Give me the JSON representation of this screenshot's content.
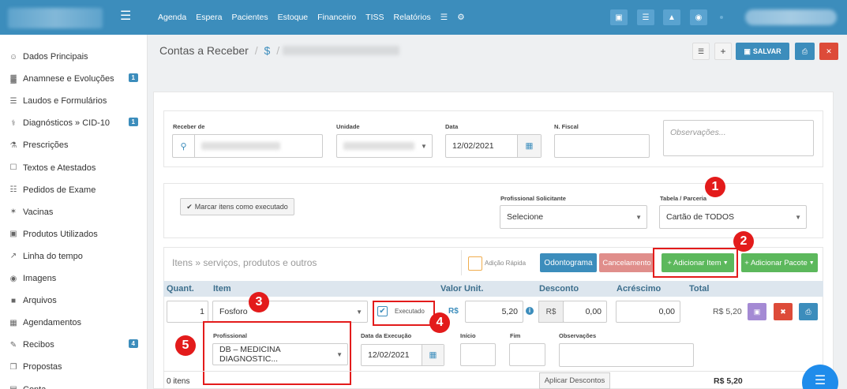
{
  "topnav": [
    "Agenda",
    "Espera",
    "Pacientes",
    "Estoque",
    "Financeiro",
    "TISS",
    "Relatórios"
  ],
  "sidebar": [
    {
      "label": "Dados Principais",
      "icon": "person-icon",
      "badge": ""
    },
    {
      "label": "Anamnese e Evoluções",
      "icon": "chart-icon",
      "badge": "1"
    },
    {
      "label": "Laudos e Formulários",
      "icon": "list-icon",
      "badge": ""
    },
    {
      "label": "Diagnósticos » CID-10",
      "icon": "stethoscope-icon",
      "badge": "1"
    },
    {
      "label": "Prescrições",
      "icon": "flask-icon",
      "badge": ""
    },
    {
      "label": "Textos e Atestados",
      "icon": "file-icon",
      "badge": ""
    },
    {
      "label": "Pedidos de Exame",
      "icon": "clipboard-icon",
      "badge": ""
    },
    {
      "label": "Vacinas",
      "icon": "syringe-icon",
      "badge": ""
    },
    {
      "label": "Produtos Utilizados",
      "icon": "medkit-icon",
      "badge": ""
    },
    {
      "label": "Linha do tempo",
      "icon": "line-chart-icon",
      "badge": ""
    },
    {
      "label": "Imagens",
      "icon": "camera-icon",
      "badge": ""
    },
    {
      "label": "Arquivos",
      "icon": "file-solid-icon",
      "badge": ""
    },
    {
      "label": "Agendamentos",
      "icon": "calendar-icon",
      "badge": ""
    },
    {
      "label": "Recibos",
      "icon": "edit-icon",
      "badge": "4"
    },
    {
      "label": "Propostas",
      "icon": "copy-icon",
      "badge": ""
    },
    {
      "label": "Conta",
      "icon": "wallet-icon",
      "badge": ""
    }
  ],
  "breadcrumb": {
    "title": "Contas a Receber",
    "sep": "/",
    "currency": "$",
    "sep2": "/"
  },
  "toolbar": {
    "save": "SALVAR"
  },
  "form": {
    "receber_label": "Receber de",
    "unidade_label": "Unidade",
    "data_label": "Data",
    "data_value": "12/02/2021",
    "nfiscal_label": "N. Fiscal",
    "obs_placeholder": "Observações..."
  },
  "actions": {
    "marcar": "Marcar itens como executado",
    "prof_label": "Profissional Solicitante",
    "prof_value": "Selecione",
    "tabela_label": "Tabela / Parceria",
    "tabela_value": "Cartão de TODOS"
  },
  "items": {
    "search_text": "Itens » serviços, produtos e outros",
    "adicao": "Adição Rápida",
    "odontograma": "Odontograma",
    "cancelamento": "Cancelamento",
    "add_item": "+ Adicionar Item",
    "add_pacote": "+ Adicionar Pacote",
    "headers": {
      "quant": "Quant.",
      "item": "Item",
      "valor": "Valor Unit.",
      "desconto": "Desconto",
      "acrescimo": "Acréscimo",
      "total": "Total"
    },
    "row": {
      "quant": "1",
      "item": "Fosforo",
      "executado": "Executado",
      "rs": "R$",
      "valor": "5,20",
      "desc_rs": "R$",
      "desconto": "0,00",
      "acrescimo": "0,00",
      "total": "R$ 5,20"
    },
    "detail": {
      "prof_label": "Profissional",
      "prof_value": "DB – MEDICINA DIAGNOSTIC...",
      "data_label": "Data da Execução",
      "data_value": "12/02/2021",
      "inicio_label": "Início",
      "fim_label": "Fim",
      "obs_label": "Observações"
    },
    "footer": {
      "count": "0 itens",
      "aplicar": "Aplicar Descontos",
      "total": "R$ 5,20"
    }
  },
  "annotations": [
    "1",
    "2",
    "3",
    "4",
    "5"
  ],
  "colors": {
    "topbar": "#3c8dbc",
    "primary": "#337ab7",
    "green": "#5cb85c",
    "danger": "#d9534f",
    "annotation": "#e31b1b"
  }
}
